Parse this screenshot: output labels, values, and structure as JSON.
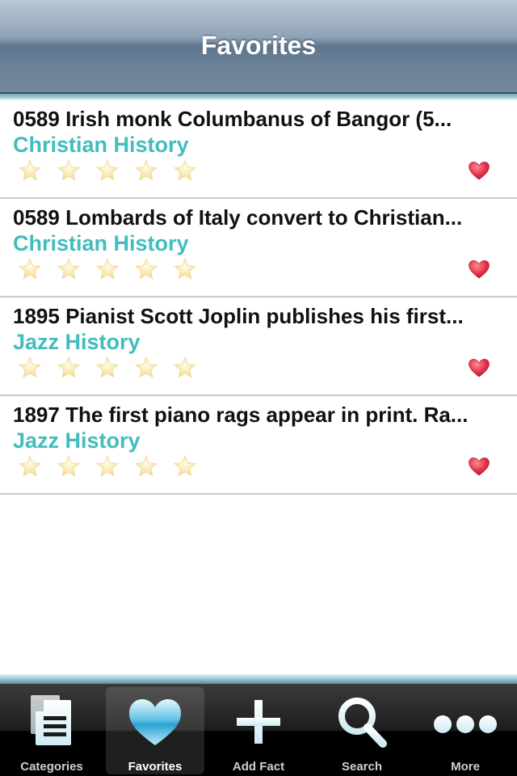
{
  "navbar": {
    "title": "Favorites"
  },
  "favorites": [
    {
      "title": "0589 Irish monk Columbanus of Bangor (5...",
      "category": "Christian History",
      "rating": 0,
      "favorited": true
    },
    {
      "title": "0589 Lombards of Italy convert to Christian...",
      "category": "Christian History",
      "rating": 0,
      "favorited": true
    },
    {
      "title": "1895 Pianist Scott Joplin publishes his first...",
      "category": "Jazz History",
      "rating": 0,
      "favorited": true
    },
    {
      "title": "1897 The first piano rags appear in print. Ra...",
      "category": "Jazz History",
      "rating": 0,
      "favorited": true
    }
  ],
  "tabbar": {
    "tabs": [
      {
        "label": "Categories",
        "icon": "document-list-icon",
        "selected": false
      },
      {
        "label": "Favorites",
        "icon": "heart-icon",
        "selected": true
      },
      {
        "label": "Add Fact",
        "icon": "plus-icon",
        "selected": false
      },
      {
        "label": "Search",
        "icon": "magnifier-icon",
        "selected": false
      },
      {
        "label": "More",
        "icon": "ellipsis-icon",
        "selected": false
      }
    ]
  },
  "colors": {
    "category_text": "#43bcbd",
    "heart": "#e8344a",
    "star_empty": "#f7e9b0"
  }
}
